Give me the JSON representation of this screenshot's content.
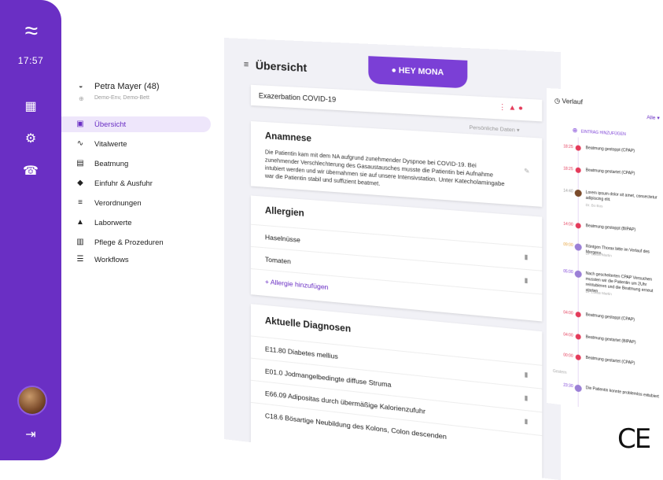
{
  "rail": {
    "time": "17:57",
    "icons": [
      "app-grid-icon",
      "gear-icon",
      "phone-icon",
      "logout-icon"
    ]
  },
  "patient": {
    "name": "Petra Mayer (48)",
    "location": "Demo-Env, Demo-Bett"
  },
  "nav": [
    {
      "label": "Übersicht",
      "icon": "patient-card-icon",
      "active": true
    },
    {
      "label": "Vitalwerte",
      "icon": "trend-icon",
      "active": false
    },
    {
      "label": "Beatmung",
      "icon": "ventilator-icon",
      "active": false
    },
    {
      "label": "Einfuhr & Ausfuhr",
      "icon": "drop-icon",
      "active": false
    },
    {
      "label": "Verordnungen",
      "icon": "list-icon",
      "active": false
    },
    {
      "label": "Laborwerte",
      "icon": "flask-icon",
      "active": false
    },
    {
      "label": "Pflege & Prozeduren",
      "icon": "clipboard-icon",
      "active": false
    },
    {
      "label": "Workflows",
      "icon": "checklist-icon",
      "active": false
    }
  ],
  "main": {
    "title": "Übersicht",
    "hey_button": "HEY MONA",
    "diagnosis_field": "Exazerbation COVID-19",
    "data_select": "Persönliche Daten",
    "anamnese": {
      "title": "Anamnese",
      "text": "Die Patientin kam mit dem NA aufgrund zunehmender Dyspnoe bei COVID-19. Bei zunehmender Verschlechterung des Gasaustausches musste die Patientin bei Aufnahme intubiert werden und wir übernahmen sie auf unsere Intensivstation. Unter Katecholamingabe war die Patientin stabil und suffizient beatmet."
    },
    "allergien": {
      "title": "Allergien",
      "items": [
        "Haselnüsse",
        "Tomaten"
      ],
      "add_label": "Allergie hinzufügen"
    },
    "diagnosen": {
      "title": "Aktuelle Diagnosen",
      "items": [
        "E11.80 Diabetes mellius",
        "E01.0 Jodmangelbedingte diffuse Struma",
        "E66.09 Adipositas durch übermäßige Kalorienzufuhr",
        "C18.6 Bösartige Neubildung des Kolons, Colon descenden"
      ]
    }
  },
  "verlauf": {
    "title": "Verlauf",
    "filter": "Alle",
    "add_entry": "EINTRAG HINZUFÜGEN",
    "day_separator": "Gestern",
    "entries": [
      {
        "time": "18:25",
        "text": "Beatmung gestoppt (CPAP)",
        "sub": "",
        "color": "#e43b5a"
      },
      {
        "time": "18:25",
        "text": "Beatmung gestartet (CPAP)",
        "sub": "",
        "color": "#e43b5a"
      },
      {
        "time": "14:40",
        "text": "Lorem ipsum dolor sit amet, consectetur adipiscing elit.",
        "sub": "Dr. Bo Bos",
        "color": "#7a4a2a"
      },
      {
        "time": "14:00",
        "text": "Beatmung gestoppt (BIPAP)",
        "sub": "",
        "color": "#e43b5a"
      },
      {
        "time": "09:00",
        "text": "Röntgen Thorax bitte im Verlauf des Morgens.",
        "sub": "Dr. Lukas Martin",
        "color": "#9b7fd6"
      },
      {
        "time": "05:00",
        "text": "Nach gescheiterten CPAP Versuchen mussten wir die Patientin um 2Uhr reintubieren und die Beatmung erneut starten",
        "sub": "Dr. Lukas Martin",
        "color": "#9b7fd6"
      },
      {
        "time": "04:00",
        "text": "Beatmung gestoppt (CPAP)",
        "sub": "",
        "color": "#e43b5a"
      },
      {
        "time": "04:00",
        "text": "Beatmung gestartet (BIPAP)",
        "sub": "",
        "color": "#e43b5a"
      },
      {
        "time": "00:00",
        "text": "Beatmung gestartet (CPAP)",
        "sub": "",
        "color": "#e43b5a"
      },
      {
        "time": "23:30",
        "text": "Die Patientin konnte problemlos extubiert",
        "sub": "",
        "color": "#9b7fd6"
      }
    ]
  },
  "ce_mark": "CE"
}
